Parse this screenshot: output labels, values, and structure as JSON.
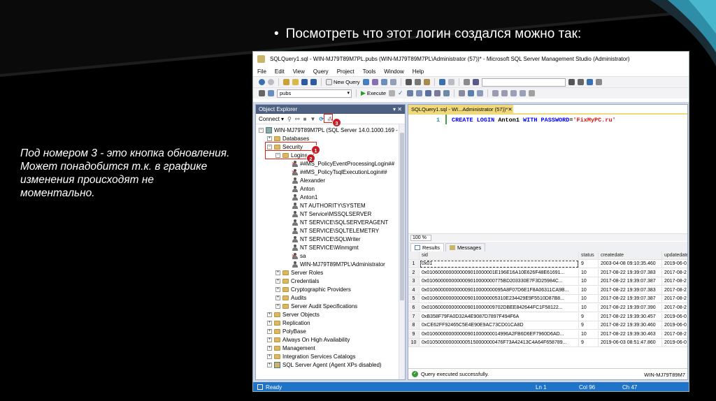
{
  "slide": {
    "bullet": "Посмотреть что этот логин создался можно так:",
    "note": "Под номером 3 - это кнопка обновления. Может понадобится т.к. в графике изменения происходят не моментально."
  },
  "window": {
    "title": "SQLQuery1.sql - WIN-MJ79T89M7PL.pubs (WIN-MJ79T89M7PL\\Administrator (57))* - Microsoft SQL Server Management Studio (Administrator)"
  },
  "menu": [
    "File",
    "Edit",
    "View",
    "Query",
    "Project",
    "Tools",
    "Window",
    "Help"
  ],
  "toolbar": {
    "new_query": "New Query",
    "database": "pubs",
    "execute": "Execute"
  },
  "object_explorer": {
    "title": "Object Explorer",
    "pin": "▾ ⁠✕",
    "connect": "Connect ▾",
    "server": "WIN-MJ79T89M7PL (SQL Server 14.0.1000.169 - W",
    "databases": "Databases",
    "security": "Security",
    "logins": "Logins",
    "logins_list": [
      "##MS_PolicyEventProcessingLogin##",
      "##MS_PolicyTsqlExecutionLogin##",
      "Alexander",
      "Anton",
      "Anton1",
      "NT AUTHORITY\\SYSTEM",
      "NT Service\\MSSQLSERVER",
      "NT SERVICE\\SQLSERVERAGENT",
      "NT SERVICE\\SQLTELEMETRY",
      "NT SERVICE\\SQLWriter",
      "NT SERVICE\\Winmgmt",
      "sa",
      "WIN-MJ79T89M7PL\\Administrator"
    ],
    "security_children": [
      "Server Roles",
      "Credentials",
      "Cryptographic Providers",
      "Audits",
      "Server Audit Specifications"
    ],
    "top_folders": [
      "Server Objects",
      "Replication",
      "PolyBase",
      "Always On High Availability",
      "Management",
      "Integration Services Catalogs"
    ],
    "agent": "SQL Server Agent (Agent XPs disabled)",
    "markers": [
      "1",
      "2",
      "3"
    ]
  },
  "editor": {
    "tab": "SQLQuery1.sql - WI...Administrator (57))*",
    "tab_close": "⁠✕",
    "line_no": "1",
    "kw1": "CREATE LOGIN",
    "ident": " Anton1 ",
    "kw2": "WITH PASSWORD",
    "eq": "=",
    "str": "'FixMyPC.ru'",
    "zoom": "100 %",
    "results_tab": "Results",
    "messages_tab": "Messages",
    "columns": [
      "sid",
      "status",
      "createdate",
      "updatedate"
    ],
    "rows": [
      [
        "1",
        "0x01",
        "9",
        "2003-04-08 09:10:35.460",
        "2019-06-0"
      ],
      [
        "2",
        "0x0106000000000009010000001E196E16A10E626F48E61691...",
        "10",
        "2017-08-22 19:39:07.383",
        "2017-08-2"
      ],
      [
        "3",
        "0x0106000000000009010000000775BD203330E7F3D25984C...",
        "10",
        "2017-08-22 19:39:07.387",
        "2017-08-2"
      ],
      [
        "4",
        "0x0106000000000009010000000095A8F07D6E1F8A06311CA9B...",
        "10",
        "2017-08-22 19:39:07.383",
        "2017-08-2"
      ],
      [
        "5",
        "0x01060000000000090100000005310E234429E9F5510D87B8...",
        "10",
        "2017-08-22 19:39:07.387",
        "2017-08-2"
      ],
      [
        "6",
        "0x0106000000000009010000009702DBEE842644FC1F58122...",
        "10",
        "2017-08-22 19:39:07.390",
        "2017-08-2"
      ],
      [
        "7",
        "0xB358F79FA0D32A4E9087D7897F494F6A",
        "9",
        "2017-08-22 19:39:30.457",
        "2019-06-0"
      ],
      [
        "8",
        "0xCE62FF92465C5E4E90E9AC73CD01CA8D",
        "9",
        "2017-08-22 19:39:30.460",
        "2019-06-0"
      ],
      [
        "9",
        "0x010600000000000901000000014996A2FB6D6EF7960D6AD...",
        "10",
        "2017-08-22 19:39:30.463",
        "2017-08-2"
      ],
      [
        "10",
        "0x0105000000000005150000000476F73A42413C4A64F658789...",
        "9",
        "2019-06-03 08:51:47.860",
        "2019-06-0"
      ]
    ],
    "status_msg": "Query executed successfully.",
    "status_server": "WIN-MJ79T89M7"
  },
  "statusbar": {
    "ready": "Ready",
    "ln": "Ln 1",
    "col": "Col 96",
    "ch": "Ch 47"
  },
  "colors": {
    "accent": "#1f74c8",
    "panel_title": "#4d6082",
    "active_tab": "#f0d97a",
    "marker": "#c81c24"
  }
}
